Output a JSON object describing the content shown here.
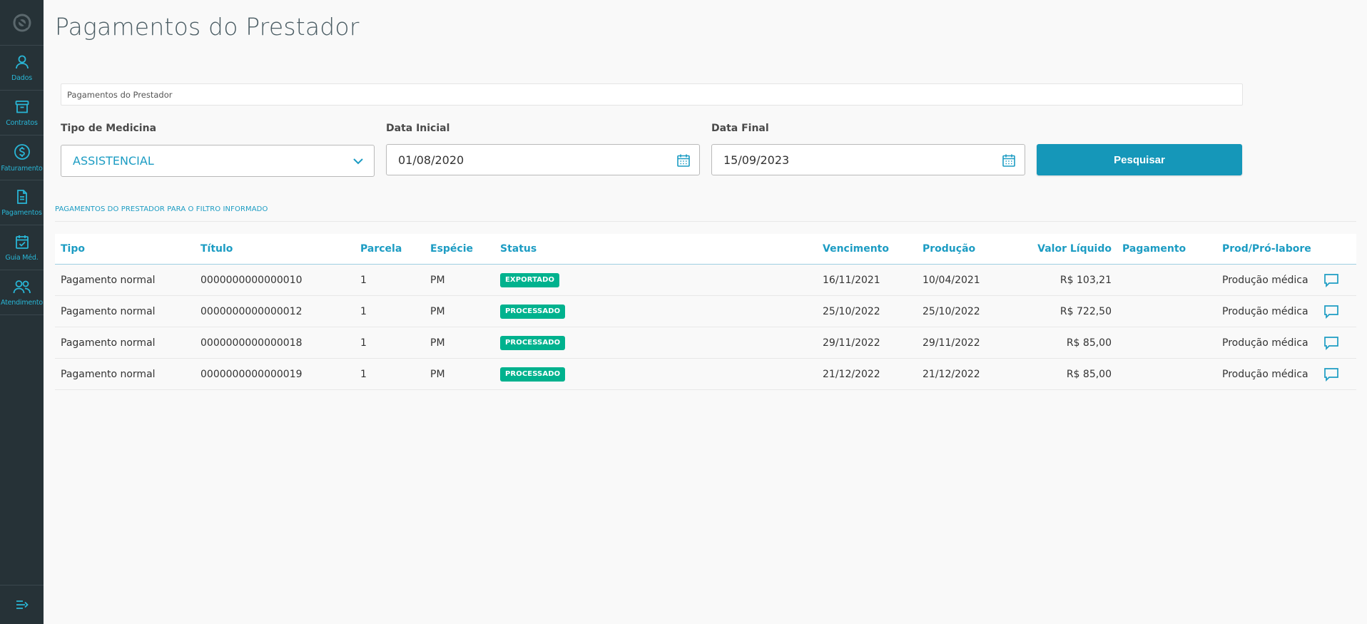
{
  "app": {
    "title": "Pagamentos do Prestador",
    "accent_color": "#1c9cc3",
    "sidebar_color": "#263237"
  },
  "sidebar": {
    "items": [
      {
        "label": "Dados",
        "icon": "user-icon"
      },
      {
        "label": "Contratos",
        "icon": "archive-icon"
      },
      {
        "label": "Faturamento",
        "icon": "dollar-icon"
      },
      {
        "label": "Pagamentos",
        "icon": "document-icon"
      },
      {
        "label": "Guia Méd.",
        "icon": "calendar-check-icon"
      },
      {
        "label": "Atendimento",
        "icon": "users-icon"
      }
    ]
  },
  "breadcrumb": {
    "text": "Pagamentos do Prestador"
  },
  "filters": {
    "tipo_medicina": {
      "label": "Tipo de Medicina",
      "value": "ASSISTENCIAL"
    },
    "data_inicial": {
      "label": "Data Inicial",
      "value": "01/08/2020"
    },
    "data_final": {
      "label": "Data Final",
      "value": "15/09/2023"
    },
    "search_label": "Pesquisar"
  },
  "results": {
    "title": "PAGAMENTOS DO PRESTADOR PARA O FILTRO INFORMADO",
    "columns": {
      "tipo": "Tipo",
      "titulo": "Título",
      "parcela": "Parcela",
      "especie": "Espécie",
      "status": "Status",
      "vencimento": "Vencimento",
      "producao": "Produção",
      "valor_liquido": "Valor Líquido",
      "pagamento": "Pagamento",
      "prod_pro_labore": "Prod/Pró-labore"
    },
    "rows": [
      {
        "tipo": "Pagamento normal",
        "titulo": "0000000000000010",
        "parcela": "1",
        "especie": "PM",
        "status": "EXPORTADO",
        "vencimento": "16/11/2021",
        "producao": "10/04/2021",
        "valor_liquido": "R$ 103,21",
        "pagamento": "",
        "prod_pro_labore": "Produção médica"
      },
      {
        "tipo": "Pagamento normal",
        "titulo": "0000000000000012",
        "parcela": "1",
        "especie": "PM",
        "status": "PROCESSADO",
        "vencimento": "25/10/2022",
        "producao": "25/10/2022",
        "valor_liquido": "R$ 722,50",
        "pagamento": "",
        "prod_pro_labore": "Produção médica"
      },
      {
        "tipo": "Pagamento normal",
        "titulo": "0000000000000018",
        "parcela": "1",
        "especie": "PM",
        "status": "PROCESSADO",
        "vencimento": "29/11/2022",
        "producao": "29/11/2022",
        "valor_liquido": "R$ 85,00",
        "pagamento": "",
        "prod_pro_labore": "Produção médica"
      },
      {
        "tipo": "Pagamento normal",
        "titulo": "0000000000000019",
        "parcela": "1",
        "especie": "PM",
        "status": "PROCESSADO",
        "vencimento": "21/12/2022",
        "producao": "21/12/2022",
        "valor_liquido": "R$ 85,00",
        "pagamento": "",
        "prod_pro_labore": "Produção médica"
      }
    ]
  }
}
